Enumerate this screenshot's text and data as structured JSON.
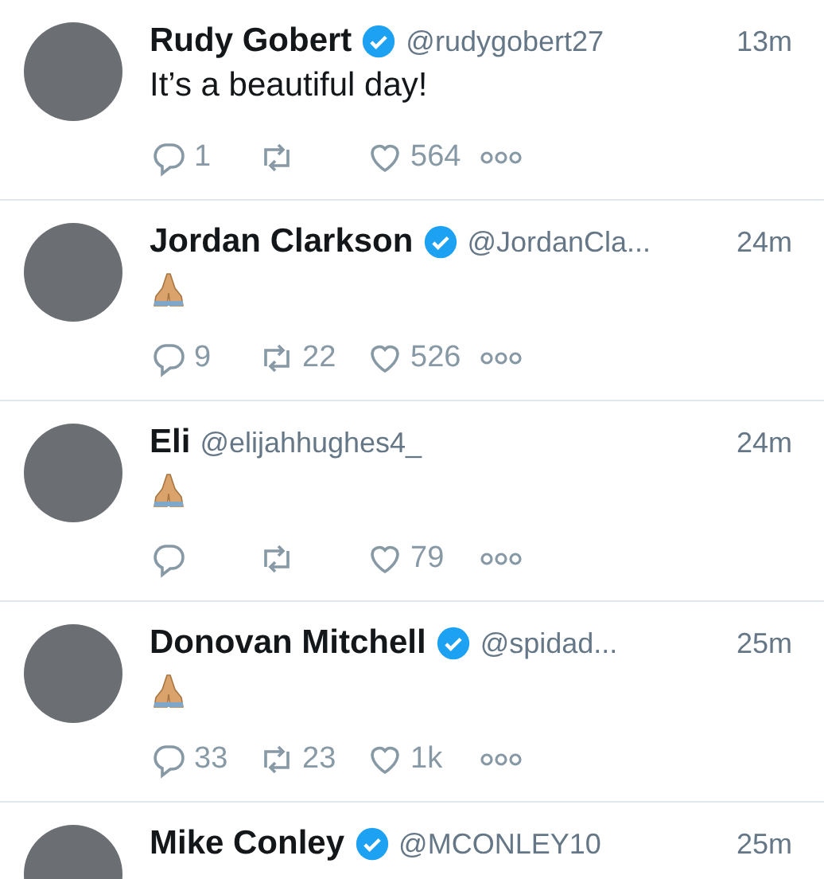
{
  "tweets": [
    {
      "name": "Rudy Gobert",
      "verified": true,
      "handle": "@rudygobert27",
      "time": "13m",
      "kind": "text",
      "body": "It’s a beautiful day!",
      "replies": "1",
      "likes": "564"
    },
    {
      "name": "Jordan Clarkson",
      "verified": true,
      "handle": "@JordanCla...",
      "time": "24m",
      "kind": "praying-hands",
      "replies": "9",
      "retweets": "22",
      "likes": "526"
    },
    {
      "name": "Eli",
      "verified": false,
      "handle": "@elijahhughes4_",
      "time": "24m",
      "kind": "praying-hands",
      "likes": "79"
    },
    {
      "name": "Donovan Mitchell",
      "verified": true,
      "handle": "@spidad...",
      "time": "25m",
      "kind": "praying-hands",
      "replies": "33",
      "retweets": "23",
      "likes": "1k"
    },
    {
      "name": "Mike Conley",
      "verified": true,
      "handle": "@MCONLEY10",
      "time": "25m"
    }
  ]
}
